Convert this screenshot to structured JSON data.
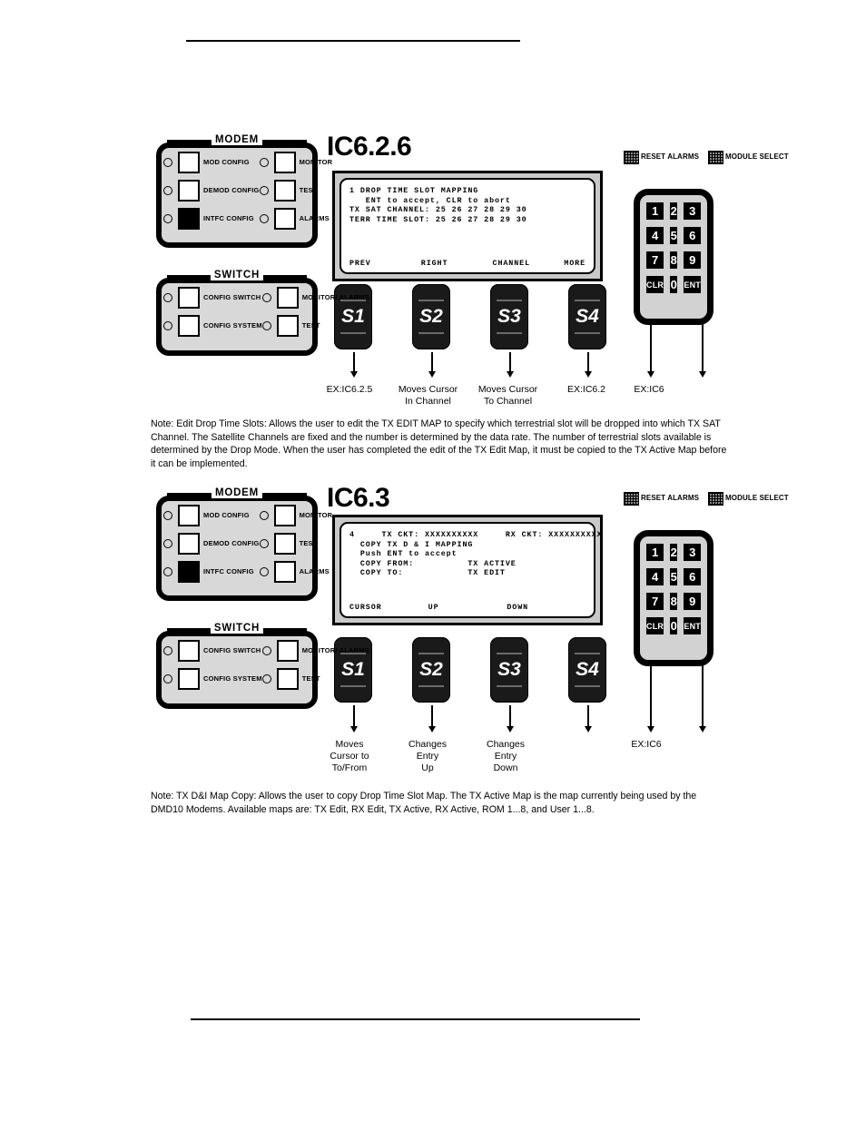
{
  "page": {
    "has_top_rule": true,
    "has_bottom_rule": true
  },
  "diagrams": [
    {
      "id": "ic626",
      "heading": "IC6.2.6",
      "panel_groups": [
        {
          "title": "MODEM",
          "left_column": [
            {
              "label": "MOD\nCONFIG",
              "led": true,
              "active": false
            },
            {
              "label": "DEMOD\nCONFIG",
              "led": true,
              "active": false
            },
            {
              "label": "INTFC\nCONFIG",
              "led": true,
              "active": true
            }
          ],
          "right_column": [
            {
              "label": "MONITOR",
              "led": true,
              "active": false
            },
            {
              "label": "TEST",
              "led": true,
              "active": false
            },
            {
              "label": "ALARMS",
              "led": true,
              "active": false
            }
          ]
        },
        {
          "title": "SWITCH",
          "left_column": [
            {
              "label": "CONFIG\nSWITCH",
              "led": true,
              "active": false
            },
            {
              "label": "CONFIG\nSYSTEM",
              "led": true,
              "active": false
            }
          ],
          "right_column": [
            {
              "label": "MONITOR/\nALARMS",
              "led": true,
              "active": false
            },
            {
              "label": "TEST",
              "led": true,
              "active": false
            }
          ]
        }
      ],
      "lcd": {
        "lines": [
          "1 DROP TIME SLOT MAPPING",
          "   ENT to accept, CLR to abort",
          "TX SAT CHANNEL: 25 26 27 28 29 30",
          "TERR TIME SLOT: 25 26 27 28 29 30"
        ],
        "softkeys": [
          "PREV",
          "RIGHT",
          "CHANNEL",
          "MORE"
        ]
      },
      "soft_buttons": [
        "S1",
        "S2",
        "S3",
        "S4"
      ],
      "top_keys": [
        {
          "label": "RESET\nALARMS"
        },
        {
          "label": "MODULE\nSELECT"
        }
      ],
      "keypad": {
        "keys": [
          "1",
          "2",
          "3",
          "4",
          "5",
          "6",
          "7",
          "8",
          "9",
          "CLR",
          "0",
          "ENT"
        ]
      },
      "callouts": [
        {
          "text": "EX:IC6.2.5",
          "source": "S1"
        },
        {
          "text": "Moves Cursor\nIn Channel",
          "source": "S2"
        },
        {
          "text": "Moves Cursor\nTo  Channel",
          "source": "S3"
        },
        {
          "text": "EX:IC6.2",
          "source": "S4"
        },
        {
          "text": "EX:IC6",
          "source": "CLR"
        },
        {
          "text": "",
          "source": "ENT"
        }
      ]
    },
    {
      "id": "ic63",
      "heading": "IC6.3",
      "panel_groups": [
        {
          "title": "MODEM",
          "left_column": [
            {
              "label": "MOD\nCONFIG",
              "led": true,
              "active": false
            },
            {
              "label": "DEMOD\nCONFIG",
              "led": true,
              "active": false
            },
            {
              "label": "INTFC\nCONFIG",
              "led": true,
              "active": true
            }
          ],
          "right_column": [
            {
              "label": "MONITOR",
              "led": true,
              "active": false
            },
            {
              "label": "TEST",
              "led": true,
              "active": false
            },
            {
              "label": "ALARMS",
              "led": true,
              "active": false
            }
          ]
        },
        {
          "title": "SWITCH",
          "left_column": [
            {
              "label": "CONFIG\nSWITCH",
              "led": true,
              "active": false
            },
            {
              "label": "CONFIG\nSYSTEM",
              "led": true,
              "active": false
            }
          ],
          "right_column": [
            {
              "label": "MONITOR/\nALARMS",
              "led": true,
              "active": false
            },
            {
              "label": "TEST",
              "led": true,
              "active": false
            }
          ]
        }
      ],
      "lcd": {
        "lines": [
          "4     TX CKT: XXXXXXXXXX     RX CKT: XXXXXXXXXX",
          "",
          "  COPY TX D & I MAPPING",
          "  Push ENT to accept",
          "  COPY FROM:          TX ACTIVE",
          "  COPY TO:            TX EDIT"
        ],
        "softkeys": [
          "CURSOR",
          "UP",
          "DOWN",
          ""
        ]
      },
      "soft_buttons": [
        "S1",
        "S2",
        "S3",
        "S4"
      ],
      "top_keys": [
        {
          "label": "RESET\nALARMS"
        },
        {
          "label": "MODULE\nSELECT"
        }
      ],
      "keypad": {
        "keys": [
          "1",
          "2",
          "3",
          "4",
          "5",
          "6",
          "7",
          "8",
          "9",
          "CLR",
          "0",
          "ENT"
        ]
      },
      "callouts": [
        {
          "text": "Moves\nCursor to\nTo/From",
          "source": "S1"
        },
        {
          "text": "Changes\nEntry\nUp",
          "source": "S2"
        },
        {
          "text": "Changes\nEntry\nDown",
          "source": "S3"
        },
        {
          "text": "",
          "source": "S4"
        },
        {
          "text": "EX:IC6",
          "source": "CLR"
        },
        {
          "text": "",
          "source": "ENT"
        }
      ]
    }
  ],
  "notes": [
    {
      "text": "Note: Edit Drop Time Slots:  Allows the user to edit the TX EDIT MAP to specify which terrestrial slot will be dropped into which TX SAT Channel. The Satellite Channels are fixed and the number is determined by the data rate. The number of terrestrial slots available is determined by the Drop Mode.  When the user has completed the edit of the TX Edit Map, it must be copied to the TX Active Map before it can be implemented."
    },
    {
      "text": "Note:  TX D&I Map Copy: Allows the user to copy Drop Time Slot Map.  The TX Active Map is the map currently being used by the DMD10 Modems. Available maps are:  TX Edit, RX Edit, TX Active, RX Active, ROM 1...8, and User 1...8."
    }
  ]
}
